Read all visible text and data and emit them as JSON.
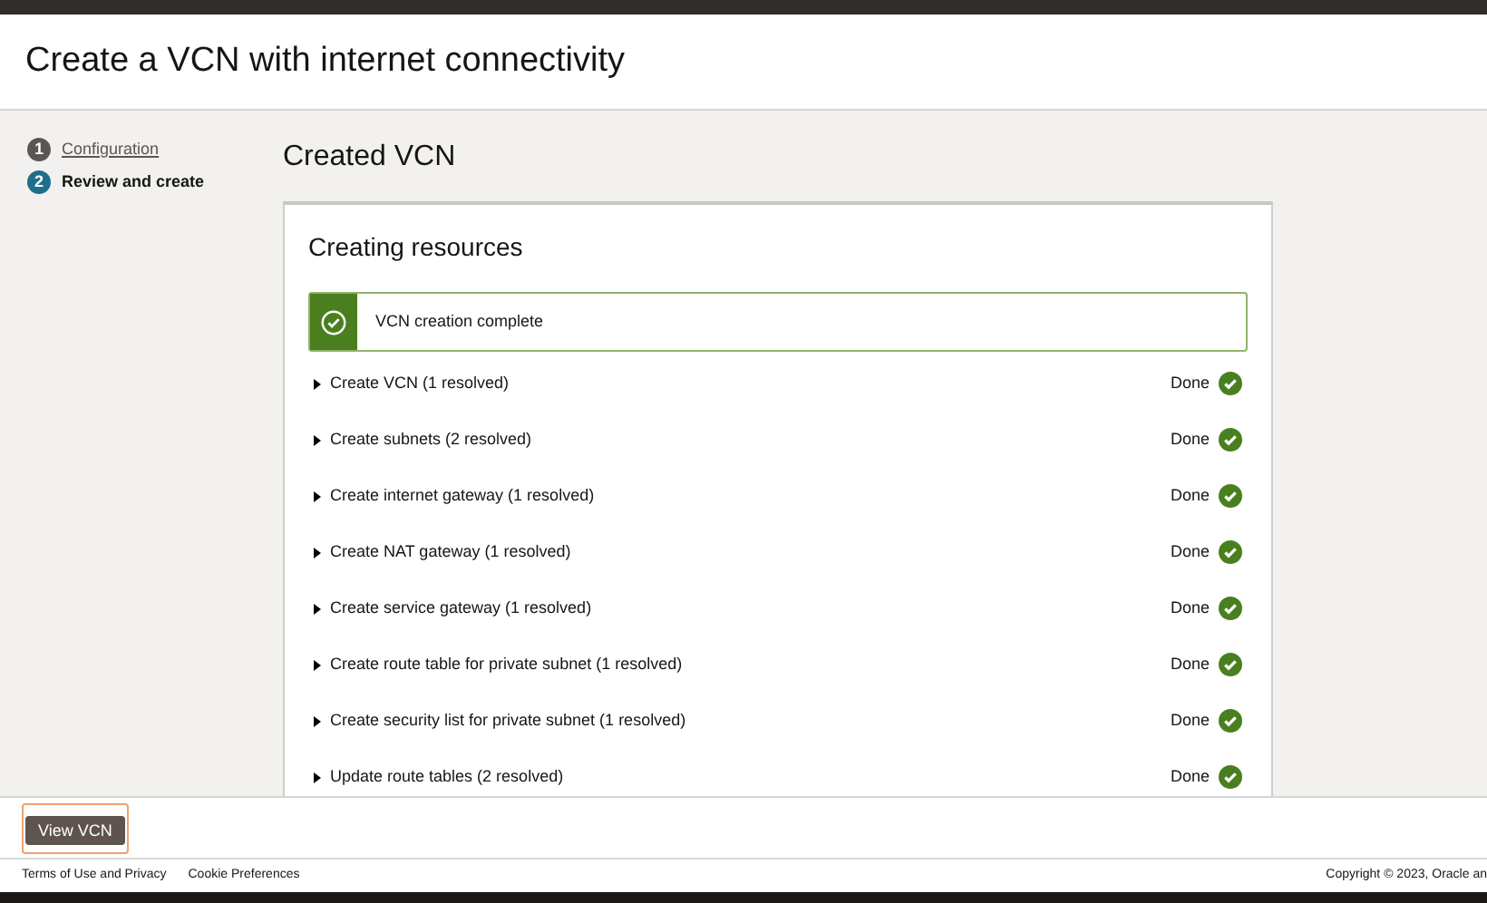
{
  "header": {
    "title": "Create a VCN with internet connectivity"
  },
  "steps": [
    {
      "number": "1",
      "label": "Configuration",
      "selected": false
    },
    {
      "number": "2",
      "label": "Review and create",
      "selected": true
    }
  ],
  "main": {
    "title": "Created VCN",
    "card_title": "Creating resources",
    "banner": "VCN creation complete",
    "tasks": [
      {
        "label": "Create VCN (1 resolved)",
        "status": "Done",
        "expanded": false
      },
      {
        "label": "Create subnets (2 resolved)",
        "status": "Done",
        "expanded": false
      },
      {
        "label": "Create internet gateway (1 resolved)",
        "status": "Done",
        "expanded": false
      },
      {
        "label": "Create NAT gateway (1 resolved)",
        "status": "Done",
        "expanded": false
      },
      {
        "label": "Create service gateway (1 resolved)",
        "status": "Done",
        "expanded": false
      },
      {
        "label": "Create route table for private subnet (1 resolved)",
        "status": "Done",
        "expanded": false
      },
      {
        "label": "Create security list for private subnet (1 resolved)",
        "status": "Done",
        "expanded": false
      },
      {
        "label": "Update route tables (2 resolved)",
        "status": "Done",
        "expanded": false
      }
    ]
  },
  "actions": {
    "primary": "View VCN"
  },
  "footer": {
    "links": [
      "Terms of Use and Privacy",
      "Cookie Preferences"
    ],
    "copyright": "Copyright © 2023, Oracle an"
  }
}
